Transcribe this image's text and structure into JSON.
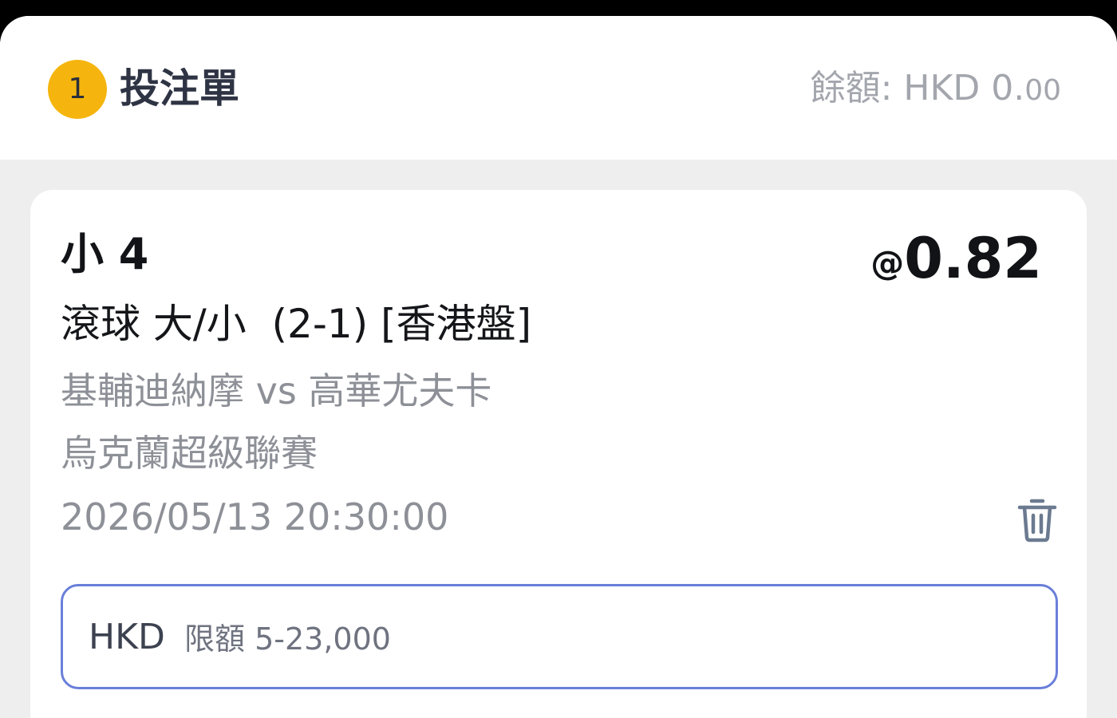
{
  "header": {
    "count": "1",
    "title": "投注單",
    "balance_label": "餘額: HKD 0.",
    "balance_decimals": "00"
  },
  "bet": {
    "selection": "小 4",
    "odds_prefix": "@",
    "odds": "0.82",
    "market": "滾球 大/小  (2-1) [香港盤]",
    "match": "基輔迪納摩 vs 高華尤夫卡",
    "league": "烏克蘭超級聯賽",
    "datetime": "2026/05/13 20:30:00",
    "delete_icon": "trash-icon"
  },
  "stake": {
    "currency": "HKD",
    "placeholder": "限額 5-23,000",
    "value": ""
  },
  "colors": {
    "badge": "#f5b50e",
    "input_border": "#6a7fd9",
    "background": "#eeeeef"
  }
}
